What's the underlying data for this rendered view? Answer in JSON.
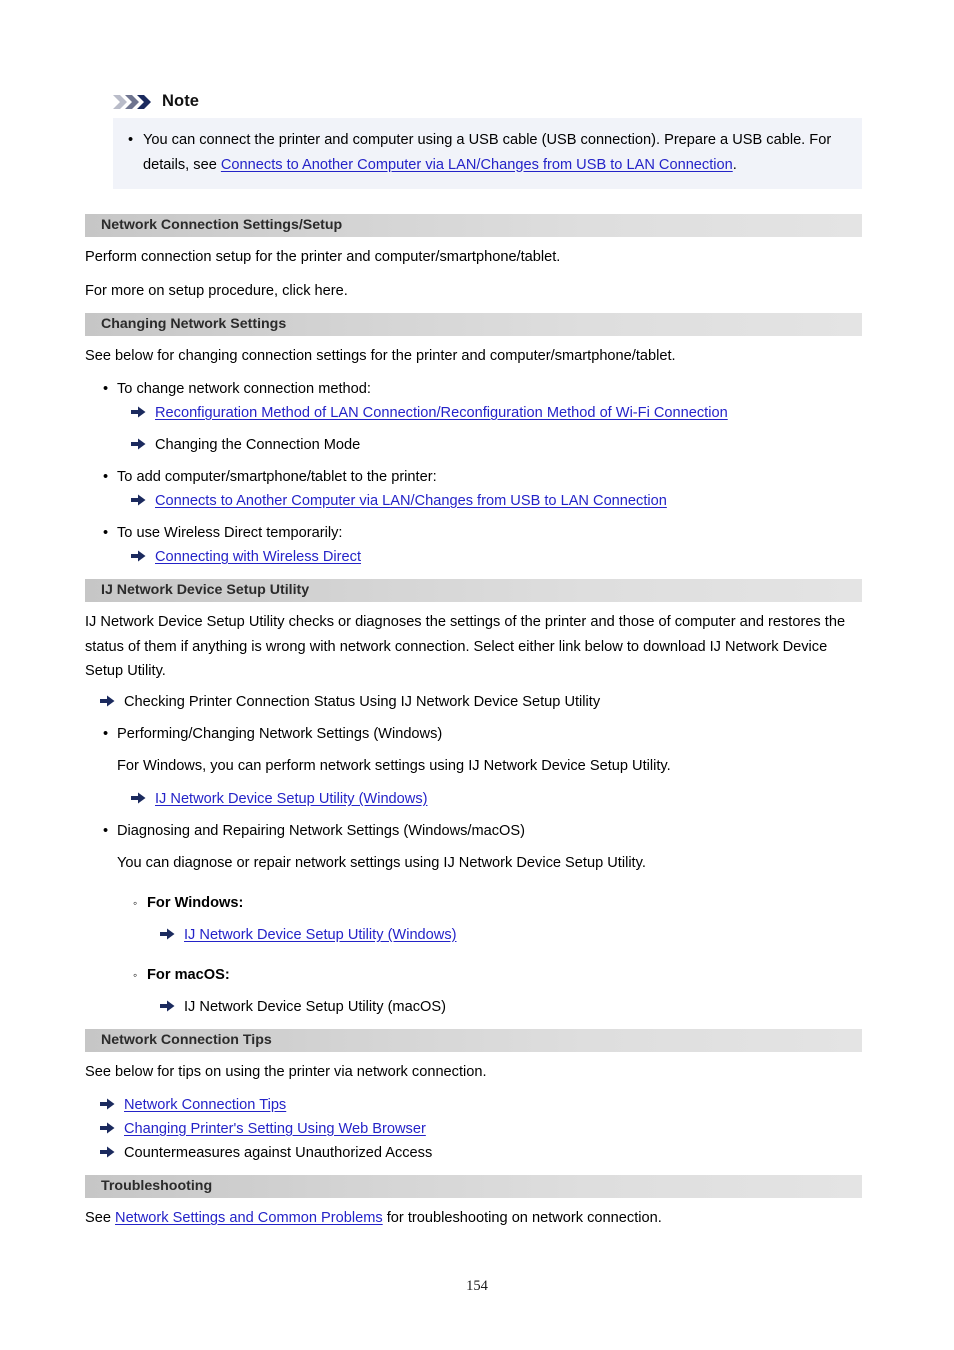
{
  "note": {
    "title": "Note",
    "bullet_glyph": "•",
    "item_prefix": "You can connect the printer and computer using a USB cable (USB connection). Prepare a USB cable. For details, see ",
    "item_link": "Connects to Another Computer via LAN/Changes from USB to LAN Connection",
    "item_suffix": "."
  },
  "sections": {
    "network_connection_settings_setup": {
      "heading": "Network Connection Settings/Setup",
      "para1": "Perform connection setup for the printer and computer/smartphone/tablet.",
      "para2": "For more on setup procedure, click here."
    },
    "changing_network_settings": {
      "heading": "Changing Network Settings",
      "intro": "See below for changing connection settings for the printer and computer/smartphone/tablet.",
      "b1": "To change network connection method:",
      "b1_a1": "Reconfiguration Method of LAN Connection/Reconfiguration Method of Wi-Fi Connection",
      "b1_a2": "Changing the Connection Mode",
      "b2": "To add computer/smartphone/tablet to the printer:",
      "b2_a1": "Connects to Another Computer via LAN/Changes from USB to LAN Connection",
      "b3": "To use Wireless Direct temporarily:",
      "b3_a1": "Connecting with Wireless Direct"
    },
    "ij_network_device_setup_utility": {
      "heading": "IJ Network Device Setup Utility",
      "intro": "IJ Network Device Setup Utility checks or diagnoses the settings of the printer and those of computer and restores the status of them if anything is wrong with network connection. Select either link below to download IJ Network Device Setup Utility.",
      "a1": "Checking Printer Connection Status Using IJ Network Device Setup Utility",
      "b1": "Performing/Changing Network Settings (Windows)",
      "b1_text": "For Windows, you can perform network settings using IJ Network Device Setup Utility.",
      "b1_a1": "IJ Network Device Setup Utility (Windows)",
      "b2": "Diagnosing and Repairing Network Settings (Windows/macOS)",
      "b2_text": "You can diagnose or repair network settings using IJ Network Device Setup Utility.",
      "b2_s1": "For Windows:",
      "b2_s1_a1": "IJ Network Device Setup Utility (Windows)",
      "b2_s2": "For macOS:",
      "b2_s2_a1": "IJ Network Device Setup Utility (macOS)"
    },
    "network_connection_tips": {
      "heading": "Network Connection Tips",
      "intro": "See below for tips on using the printer via network connection.",
      "a1": "Network Connection Tips",
      "a2": "Changing Printer's Setting Using Web Browser",
      "a3": "Countermeasures against Unauthorized Access"
    },
    "troubleshooting": {
      "heading": "Troubleshooting",
      "text_prefix": "See ",
      "text_link": "Network Settings and Common Problems",
      "text_suffix": " for troubleshooting on network connection."
    }
  },
  "bullets": {
    "disc": "•",
    "circle": "◦"
  },
  "footer": {
    "page_number": "154"
  },
  "colors": {
    "link": "#2423c8",
    "note_background": "#f1f3f9",
    "section_bar_start": "#c6c6c6",
    "section_bar_end": "#e4e4e4",
    "arrow_icon": "#1b2a5e"
  }
}
